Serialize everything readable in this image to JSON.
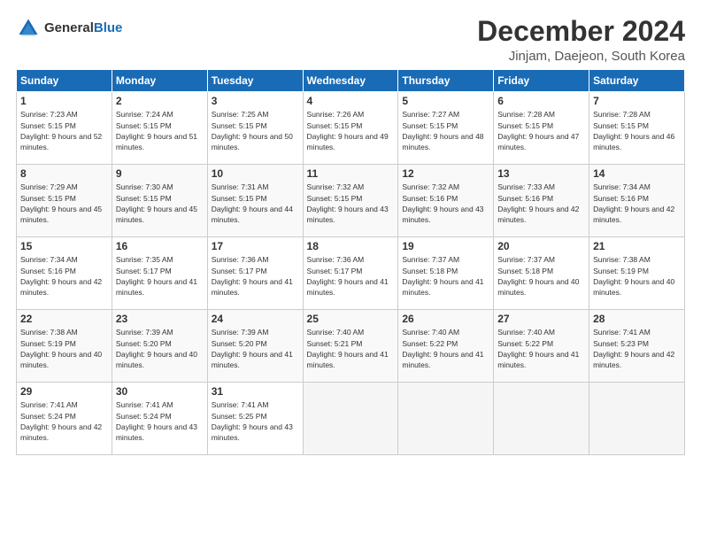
{
  "header": {
    "logo_general": "General",
    "logo_blue": "Blue",
    "month": "December 2024",
    "location": "Jinjam, Daejeon, South Korea"
  },
  "weekdays": [
    "Sunday",
    "Monday",
    "Tuesday",
    "Wednesday",
    "Thursday",
    "Friday",
    "Saturday"
  ],
  "weeks": [
    [
      {
        "day": "1",
        "sunrise": "Sunrise: 7:23 AM",
        "sunset": "Sunset: 5:15 PM",
        "daylight": "Daylight: 9 hours and 52 minutes."
      },
      {
        "day": "2",
        "sunrise": "Sunrise: 7:24 AM",
        "sunset": "Sunset: 5:15 PM",
        "daylight": "Daylight: 9 hours and 51 minutes."
      },
      {
        "day": "3",
        "sunrise": "Sunrise: 7:25 AM",
        "sunset": "Sunset: 5:15 PM",
        "daylight": "Daylight: 9 hours and 50 minutes."
      },
      {
        "day": "4",
        "sunrise": "Sunrise: 7:26 AM",
        "sunset": "Sunset: 5:15 PM",
        "daylight": "Daylight: 9 hours and 49 minutes."
      },
      {
        "day": "5",
        "sunrise": "Sunrise: 7:27 AM",
        "sunset": "Sunset: 5:15 PM",
        "daylight": "Daylight: 9 hours and 48 minutes."
      },
      {
        "day": "6",
        "sunrise": "Sunrise: 7:28 AM",
        "sunset": "Sunset: 5:15 PM",
        "daylight": "Daylight: 9 hours and 47 minutes."
      },
      {
        "day": "7",
        "sunrise": "Sunrise: 7:28 AM",
        "sunset": "Sunset: 5:15 PM",
        "daylight": "Daylight: 9 hours and 46 minutes."
      }
    ],
    [
      {
        "day": "8",
        "sunrise": "Sunrise: 7:29 AM",
        "sunset": "Sunset: 5:15 PM",
        "daylight": "Daylight: 9 hours and 45 minutes."
      },
      {
        "day": "9",
        "sunrise": "Sunrise: 7:30 AM",
        "sunset": "Sunset: 5:15 PM",
        "daylight": "Daylight: 9 hours and 45 minutes."
      },
      {
        "day": "10",
        "sunrise": "Sunrise: 7:31 AM",
        "sunset": "Sunset: 5:15 PM",
        "daylight": "Daylight: 9 hours and 44 minutes."
      },
      {
        "day": "11",
        "sunrise": "Sunrise: 7:32 AM",
        "sunset": "Sunset: 5:15 PM",
        "daylight": "Daylight: 9 hours and 43 minutes."
      },
      {
        "day": "12",
        "sunrise": "Sunrise: 7:32 AM",
        "sunset": "Sunset: 5:16 PM",
        "daylight": "Daylight: 9 hours and 43 minutes."
      },
      {
        "day": "13",
        "sunrise": "Sunrise: 7:33 AM",
        "sunset": "Sunset: 5:16 PM",
        "daylight": "Daylight: 9 hours and 42 minutes."
      },
      {
        "day": "14",
        "sunrise": "Sunrise: 7:34 AM",
        "sunset": "Sunset: 5:16 PM",
        "daylight": "Daylight: 9 hours and 42 minutes."
      }
    ],
    [
      {
        "day": "15",
        "sunrise": "Sunrise: 7:34 AM",
        "sunset": "Sunset: 5:16 PM",
        "daylight": "Daylight: 9 hours and 42 minutes."
      },
      {
        "day": "16",
        "sunrise": "Sunrise: 7:35 AM",
        "sunset": "Sunset: 5:17 PM",
        "daylight": "Daylight: 9 hours and 41 minutes."
      },
      {
        "day": "17",
        "sunrise": "Sunrise: 7:36 AM",
        "sunset": "Sunset: 5:17 PM",
        "daylight": "Daylight: 9 hours and 41 minutes."
      },
      {
        "day": "18",
        "sunrise": "Sunrise: 7:36 AM",
        "sunset": "Sunset: 5:17 PM",
        "daylight": "Daylight: 9 hours and 41 minutes."
      },
      {
        "day": "19",
        "sunrise": "Sunrise: 7:37 AM",
        "sunset": "Sunset: 5:18 PM",
        "daylight": "Daylight: 9 hours and 41 minutes."
      },
      {
        "day": "20",
        "sunrise": "Sunrise: 7:37 AM",
        "sunset": "Sunset: 5:18 PM",
        "daylight": "Daylight: 9 hours and 40 minutes."
      },
      {
        "day": "21",
        "sunrise": "Sunrise: 7:38 AM",
        "sunset": "Sunset: 5:19 PM",
        "daylight": "Daylight: 9 hours and 40 minutes."
      }
    ],
    [
      {
        "day": "22",
        "sunrise": "Sunrise: 7:38 AM",
        "sunset": "Sunset: 5:19 PM",
        "daylight": "Daylight: 9 hours and 40 minutes."
      },
      {
        "day": "23",
        "sunrise": "Sunrise: 7:39 AM",
        "sunset": "Sunset: 5:20 PM",
        "daylight": "Daylight: 9 hours and 40 minutes."
      },
      {
        "day": "24",
        "sunrise": "Sunrise: 7:39 AM",
        "sunset": "Sunset: 5:20 PM",
        "daylight": "Daylight: 9 hours and 41 minutes."
      },
      {
        "day": "25",
        "sunrise": "Sunrise: 7:40 AM",
        "sunset": "Sunset: 5:21 PM",
        "daylight": "Daylight: 9 hours and 41 minutes."
      },
      {
        "day": "26",
        "sunrise": "Sunrise: 7:40 AM",
        "sunset": "Sunset: 5:22 PM",
        "daylight": "Daylight: 9 hours and 41 minutes."
      },
      {
        "day": "27",
        "sunrise": "Sunrise: 7:40 AM",
        "sunset": "Sunset: 5:22 PM",
        "daylight": "Daylight: 9 hours and 41 minutes."
      },
      {
        "day": "28",
        "sunrise": "Sunrise: 7:41 AM",
        "sunset": "Sunset: 5:23 PM",
        "daylight": "Daylight: 9 hours and 42 minutes."
      }
    ],
    [
      {
        "day": "29",
        "sunrise": "Sunrise: 7:41 AM",
        "sunset": "Sunset: 5:24 PM",
        "daylight": "Daylight: 9 hours and 42 minutes."
      },
      {
        "day": "30",
        "sunrise": "Sunrise: 7:41 AM",
        "sunset": "Sunset: 5:24 PM",
        "daylight": "Daylight: 9 hours and 43 minutes."
      },
      {
        "day": "31",
        "sunrise": "Sunrise: 7:41 AM",
        "sunset": "Sunset: 5:25 PM",
        "daylight": "Daylight: 9 hours and 43 minutes."
      },
      null,
      null,
      null,
      null
    ]
  ]
}
